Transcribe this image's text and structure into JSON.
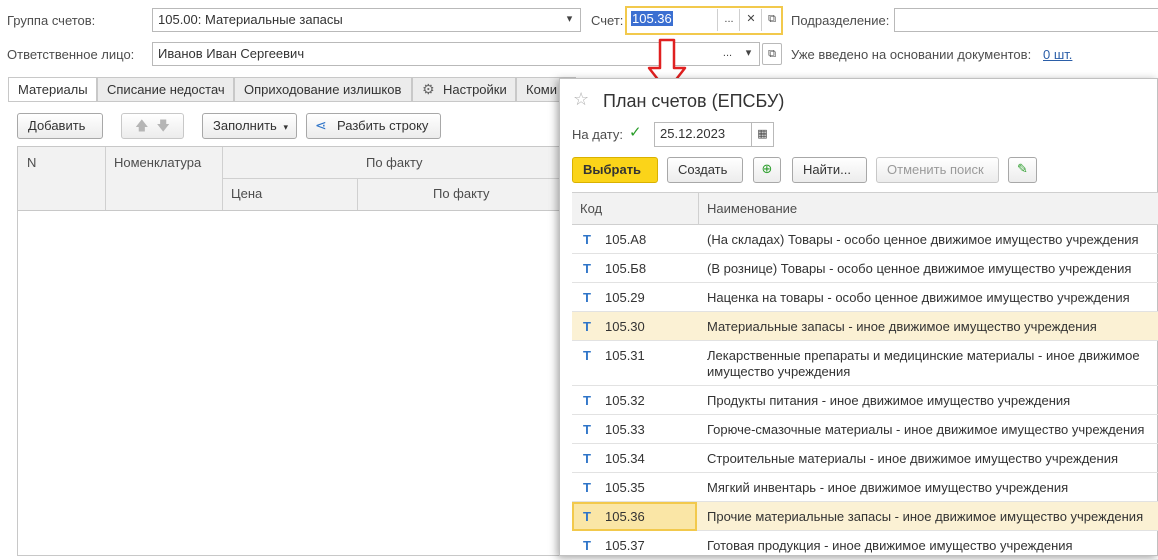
{
  "header": {
    "group_label": "Группа счетов:",
    "group_value": "105.00: Материальные запасы",
    "account_label": "Счет:",
    "account_value": "105.36",
    "subdivision_label": "Подразделение:",
    "subdivision_value": "",
    "responsible_label": "Ответственное лицо:",
    "responsible_value": "Иванов Иван Сергеевич",
    "based_on_label": "Уже введено на основании документов:",
    "based_on_link": "0 шт."
  },
  "tabs": [
    {
      "label": "Материалы"
    },
    {
      "label": "Списание недостач"
    },
    {
      "label": "Оприходование излишков"
    },
    {
      "label": "Настройки"
    },
    {
      "label": "Коми"
    }
  ],
  "toolbar": {
    "add_label": "Добавить",
    "fill_label": "Заполнить",
    "split_label": "Разбить строку"
  },
  "table": {
    "col_n": "N",
    "col_nomenclature": "Номенклатура",
    "col_actual": "По факту",
    "col_price": "Цена",
    "col_actual_sub": "По факту"
  },
  "popup": {
    "title": "План счетов (ЕПСБУ)",
    "date_label": "На дату:",
    "date_value": "25.12.2023",
    "select_label": "Выбрать",
    "create_label": "Создать",
    "find_label": "Найти...",
    "cancel_search_label": "Отменить поиск",
    "col_code": "Код",
    "col_name": "Наименование",
    "rows": [
      {
        "t": "Т",
        "code": "105.А8",
        "name": "(На складах) Товары - особо ценное движимое имущество учреждения"
      },
      {
        "t": "Т",
        "code": "105.Б8",
        "name": "(В рознице) Товары - особо ценное движимое имущество учреждения"
      },
      {
        "t": "Т",
        "code": "105.29",
        "name": "Наценка на товары - особо ценное движимое имущество учреждения"
      },
      {
        "t": "Т",
        "code": "105.30",
        "name": "Материальные запасы - иное движимое имущество учреждения"
      },
      {
        "t": "Т",
        "code": "105.31",
        "name": "Лекарственные препараты и медицинские материалы - иное движимое имущество учреждения"
      },
      {
        "t": "Т",
        "code": "105.32",
        "name": "Продукты питания - иное движимое имущество учреждения"
      },
      {
        "t": "Т",
        "code": "105.33",
        "name": "Горюче-смазочные материалы - иное движимое имущество учреждения"
      },
      {
        "t": "Т",
        "code": "105.34",
        "name": "Строительные материалы - иное движимое имущество учреждения"
      },
      {
        "t": "Т",
        "code": "105.35",
        "name": "Мягкий инвентарь - иное движимое имущество учреждения"
      },
      {
        "t": "Т",
        "code": "105.36",
        "name": "Прочие материальные запасы - иное движимое имущество учреждения"
      },
      {
        "t": "Т",
        "code": "105.37",
        "name": "Готовая продукция - иное движимое имущество учреждения"
      }
    ]
  },
  "colors": {
    "accent_yellow": "#fbd419",
    "highlight_row": "#fbf1d4",
    "arrow_red": "#e02020",
    "tree_icon_blue": "#2e74c8"
  }
}
